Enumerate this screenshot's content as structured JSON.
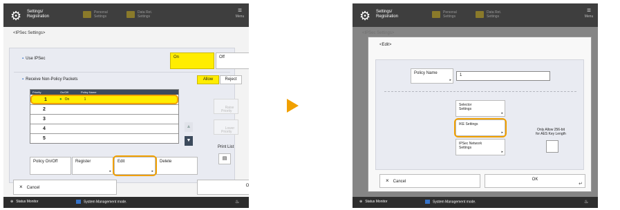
{
  "left": {
    "app_title": "Settings/\nRegistration",
    "shortcut1": "Personal\nSettings",
    "shortcut2": "Data Ret.\nSettings",
    "menu": "Menu",
    "breadcrumb": "<IPSec Settings>",
    "use_ipsec": {
      "label": "Use IPSec",
      "on": "On",
      "off": "Off",
      "selected": "On"
    },
    "receive_non_policy": {
      "label": "Receive Non-Policy Packets",
      "allow": "Allow",
      "reject": "Reject",
      "selected": "Allow"
    },
    "table": {
      "columns": [
        "Priority",
        "On/Off",
        "Policy Name"
      ],
      "rows": [
        {
          "num": "1",
          "on_off": "On",
          "name": "1",
          "selected": true
        },
        {
          "num": "2",
          "on_off": "",
          "name": "",
          "selected": false
        },
        {
          "num": "3",
          "on_off": "",
          "name": "",
          "selected": false
        },
        {
          "num": "4",
          "on_off": "",
          "name": "",
          "selected": false
        },
        {
          "num": "5",
          "on_off": "",
          "name": "",
          "selected": false
        }
      ]
    },
    "raise_priority": "Raise\nPriority",
    "lower_priority": "Lower\nPriority",
    "print_list": "Print List",
    "policy_onoff": "Policy On/Off",
    "register": "Register",
    "edit": "Edit",
    "delete": "Delete",
    "cancel": "Cancel",
    "ok": "OK"
  },
  "right": {
    "app_title": "Settings/\nRegistration",
    "shortcut1": "Personal\nSettings",
    "shortcut2": "Data Ret.\nSettings",
    "menu": "Menu",
    "breadcrumb": "<IPSec Settings>",
    "dialog_title": "<Edit>",
    "policy_name_label": "Policy Name",
    "policy_name_value": "1",
    "selector_settings": "Selector\nSettings",
    "ike_settings": "IKE Settings",
    "ipsec_network_settings": "IPSec Network\nSettings",
    "only_allow_note": "Only Allow 256-bit\nfor AES Key Length",
    "cancel": "Cancel",
    "ok": "OK"
  },
  "status_monitor": "Status Monitor",
  "system_management": "System Management mode.",
  "colors": {
    "selected_yellow": "#ffed00",
    "highlight_orange": "#f1a000",
    "topbar": "#3e3e3e",
    "panel": "#e9ebf2"
  }
}
